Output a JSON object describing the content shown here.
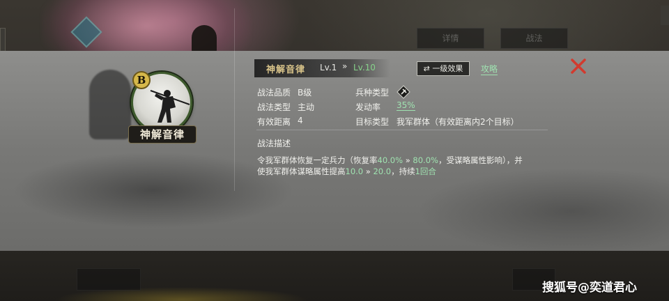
{
  "background": {
    "tab_1": "详情",
    "tab_2": "战法"
  },
  "skill": {
    "grade_badge": "B",
    "name_plate": "神解音律",
    "header_name": "神解音律",
    "level_current": "Lv.1",
    "level_arrow": "»",
    "level_max": "Lv.10",
    "effect_button": "⇄ 一级效果",
    "guide_link": "攻略"
  },
  "attributes": {
    "quality_label": "战法品质",
    "quality_value": "B级",
    "type_label": "战法类型",
    "type_value": "主动",
    "range_label": "有效距离",
    "range_value": "4",
    "troop_label": "兵种类型",
    "rate_label": "发动率",
    "rate_value": "35%",
    "target_label": "目标类型",
    "target_value": "我军群体（有效距离内2个目标）"
  },
  "description": {
    "title": "战法描述",
    "l1_a": "令我军群体恢复一定兵力（恢复率",
    "l1_v1": "40.0%",
    "l1_arrow": " » ",
    "l1_v2": "80.0%",
    "l1_b": "，受谋略属性影响），并",
    "l2_a": "使我军群体谋略属性提高",
    "l2_v1": "10.0",
    "l2_arrow": " » ",
    "l2_v2": "20.0",
    "l2_b": "，持续",
    "l2_v3": "1回合"
  },
  "watermark": "搜狐号@奕道君心",
  "colors": {
    "accent_green": "#9fe2b0",
    "gold": "#d9c48a",
    "close_red": "#d23a2e"
  },
  "icons": {
    "close": "close-x-icon",
    "troop": "troop-type-icon",
    "swap": "swap-arrows-icon"
  }
}
